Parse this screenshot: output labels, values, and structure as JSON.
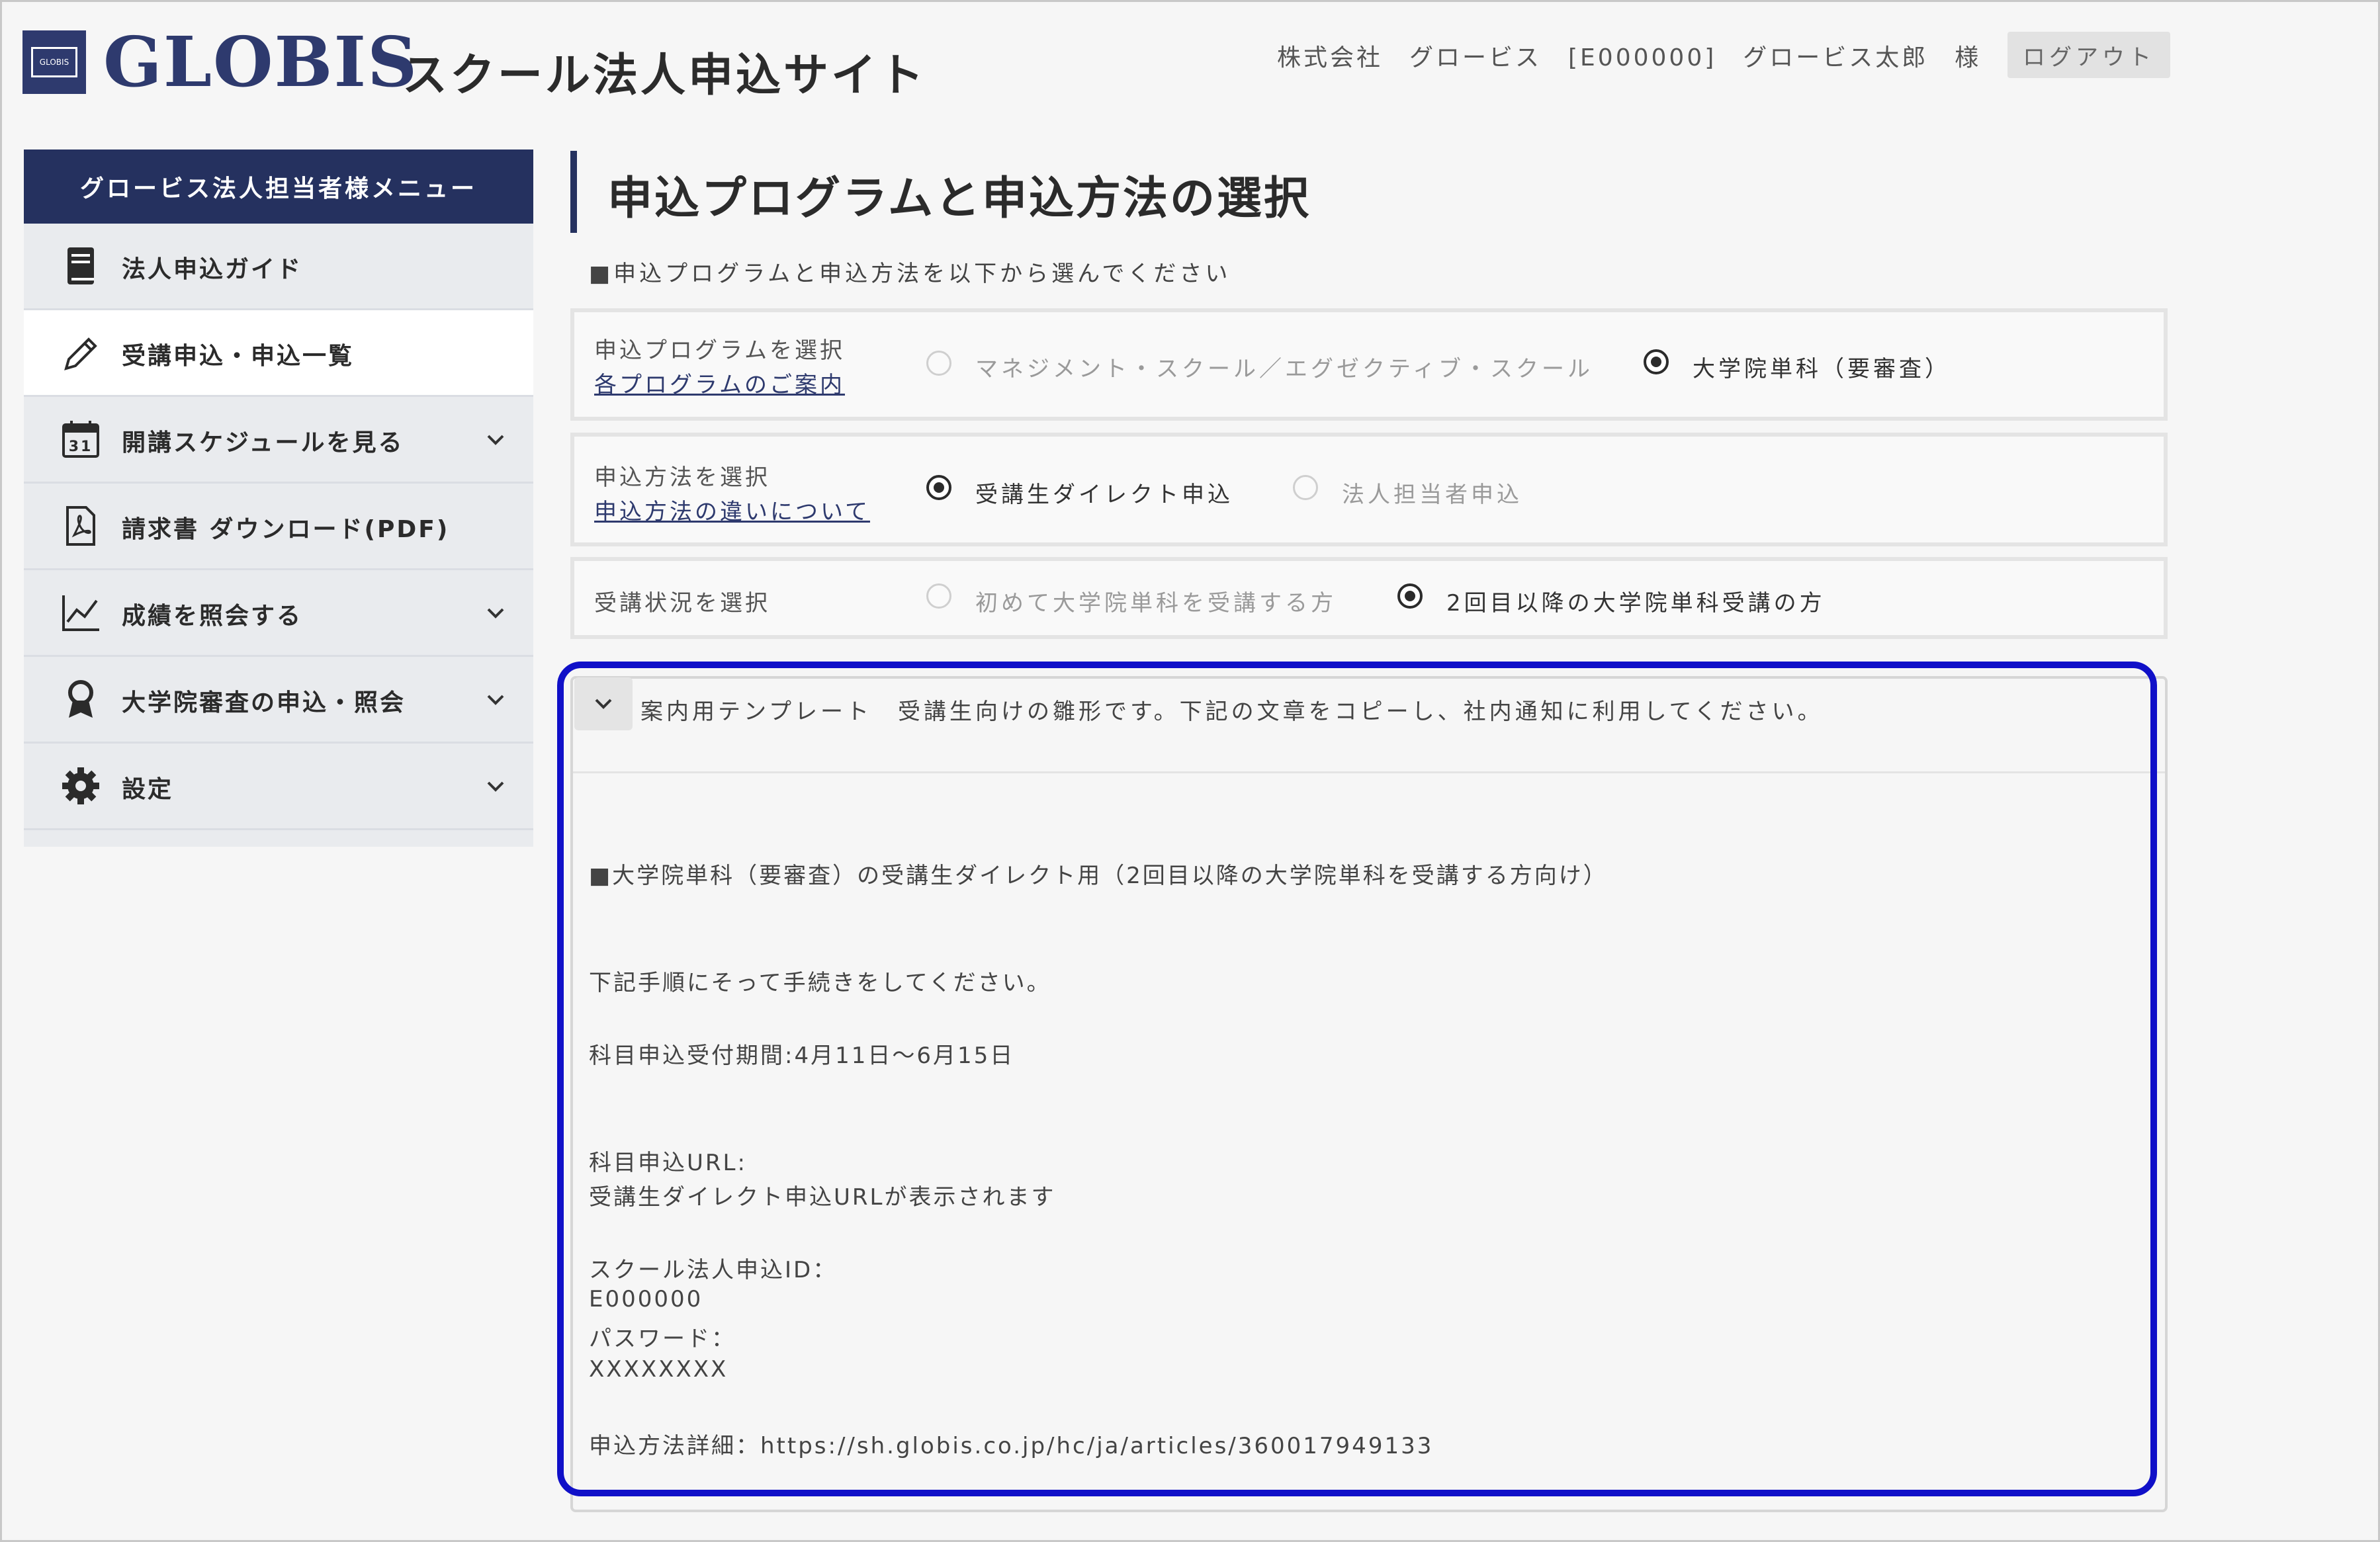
{
  "header": {
    "logo_text": "GLOBIS",
    "logo_mark": "GLOBIS",
    "site_title": "スクール法人申込サイト",
    "user_info": "株式会社　グロービス　[E000000]　グロービス太郎　様",
    "logout_label": "ログアウト"
  },
  "sidebar": {
    "title": "グロービス法人担当者様メニュー",
    "calendar_day": "31",
    "items": [
      {
        "label": "法人申込ガイド",
        "icon": "book-icon",
        "active": false,
        "expandable": false
      },
      {
        "label": "受講申込・申込一覧",
        "icon": "pencil-icon",
        "active": true,
        "expandable": false
      },
      {
        "label": "開講スケジュールを見る",
        "icon": "calendar-icon",
        "active": false,
        "expandable": true
      },
      {
        "label": "請求書 ダウンロード(PDF)",
        "icon": "pdf-icon",
        "active": false,
        "expandable": false
      },
      {
        "label": "成績を照会する",
        "icon": "chart-icon",
        "active": false,
        "expandable": true
      },
      {
        "label": "大学院審査の申込・照会",
        "icon": "award-icon",
        "active": false,
        "expandable": true
      },
      {
        "label": "設定",
        "icon": "gear-icon",
        "active": false,
        "expandable": true
      }
    ]
  },
  "main": {
    "title": "申込プログラムと申込方法の選択",
    "subtitle": "■申込プログラムと申込方法を以下から選んでください",
    "program": {
      "label": "申込プログラムを選択",
      "link": "各プログラムのご案内",
      "options": [
        "マネジメント・スクール／エグゼクティブ・スクール",
        "大学院単科（要審査）"
      ],
      "selected": 1
    },
    "method": {
      "label": "申込方法を選択",
      "link": "申込方法の違いについて",
      "options": [
        "受講生ダイレクト申込",
        "法人担当者申込"
      ],
      "selected": 0
    },
    "status": {
      "label": "受講状況を選択",
      "options": [
        "初めて大学院単科を受講する方",
        "2回目以降の大学院単科受講の方"
      ],
      "selected": 1
    },
    "template": {
      "header": "案内用テンプレート　受講生向けの雛形です。下記の文章をコピーし、社内通知に利用してください。",
      "heading": "■大学院単科（要審査）の受講生ダイレクト用（2回目以降の大学院単科を受講する方向け）",
      "instruction": "下記手順にそって手続きをしてください。",
      "period": "科目申込受付期間:4月11日～6月15日",
      "url_label": "科目申込URL:",
      "url_note": "受講生ダイレクト申込URLが表示されます",
      "id_label": "スクール法人申込ID：",
      "id_value": "E000000",
      "pw_label": "パスワード：",
      "pw_value": "XXXXXXXX",
      "detail": "申込方法詳細：https://sh.globis.co.jp/hc/ja/articles/360017949133"
    }
  },
  "colors": {
    "navy": "#25315f",
    "highlight": "#1010c8"
  }
}
